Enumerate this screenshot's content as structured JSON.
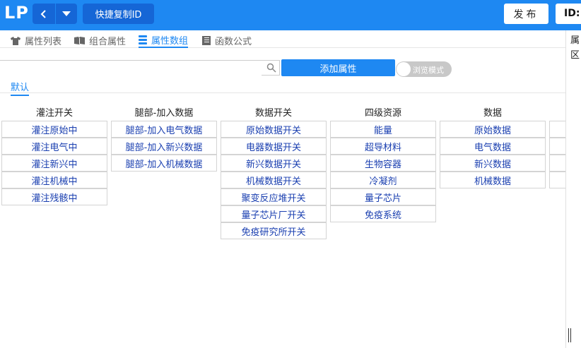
{
  "header": {
    "logo": "LP",
    "copy_id_label": "快捷复制ID",
    "publish_label": "发布",
    "id_label": "ID:"
  },
  "tabs": [
    {
      "label": "属性列表",
      "icon": "shirt-icon"
    },
    {
      "label": "组合属性",
      "icon": "book-icon"
    },
    {
      "label": "属性数组",
      "icon": "database-icon"
    },
    {
      "label": "函数公式",
      "icon": "document-icon"
    }
  ],
  "active_tab": "属性数组",
  "right_panel": {
    "line1": "属",
    "line2": "区"
  },
  "search": {
    "placeholder": "",
    "value": ""
  },
  "add_button_label": "添加属性",
  "toggle_label": "浏览模式",
  "group_tab_label": "默认",
  "columns": [
    {
      "title": "灌注开关",
      "items": [
        "灌注原始中",
        "灌注电气中",
        "灌注新兴中",
        "灌注机械中",
        "灌注残骸中"
      ]
    },
    {
      "title": "腿部-加入数据",
      "items": [
        "腿部-加入电气数据",
        "腿部-加入新兴数据",
        "腿部-加入机械数据"
      ]
    },
    {
      "title": "数据开关",
      "items": [
        "原始数据开关",
        "电器数据开关",
        "新兴数据开关",
        "机械数据开关",
        "聚变反应堆开关",
        "量子芯片厂开关",
        "免疫研究所开关"
      ]
    },
    {
      "title": "四级资源",
      "items": [
        "能量",
        "超导材料",
        "生物容器",
        "冷凝剂",
        "量子芯片",
        "免疫系统"
      ]
    },
    {
      "title": "数据",
      "items": [
        "原始数据",
        "电气数据",
        "新兴数据",
        "机械数据"
      ]
    },
    {
      "title": "",
      "items": [
        "",
        "",
        "",
        ""
      ]
    }
  ],
  "colors": {
    "accent": "#1e88f2",
    "header_dark": "#1566d6",
    "item_text": "#1a3fb0"
  }
}
